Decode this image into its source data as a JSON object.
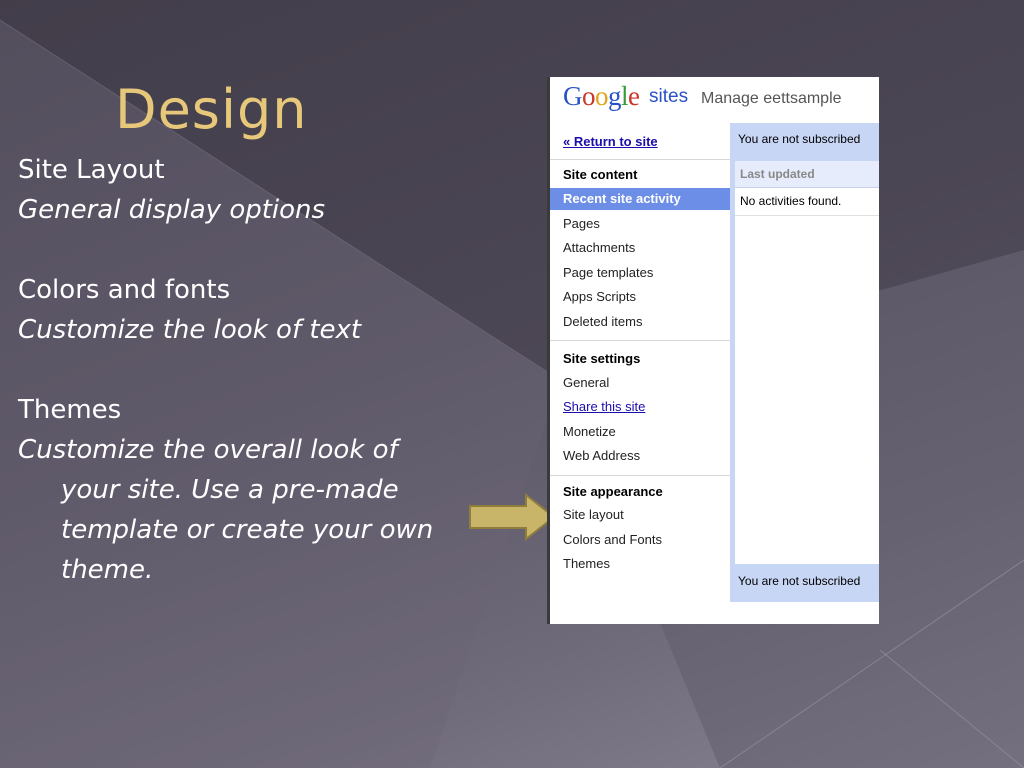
{
  "slide": {
    "title": "Design",
    "bullets": [
      {
        "text": "Site Layout"
      },
      {
        "text": "General display options"
      },
      {
        "text": "Colors and fonts"
      },
      {
        "text": "Customize the look of text"
      },
      {
        "text": "Themes"
      },
      {
        "text": "Customize the overall look of your site.  Use a pre-made template or create your own theme."
      }
    ],
    "arrow_icon": "right-arrow-icon",
    "accent_color": "#e7c87a",
    "arrow_color": "#c9b56a"
  },
  "screenshot": {
    "logo": {
      "google": "Google",
      "sites": "sites"
    },
    "header_title": "Manage eettsample",
    "return_link": "« Return to site",
    "sections": {
      "content": {
        "heading": "Site content",
        "items": [
          "Recent site activity",
          "Pages",
          "Attachments",
          "Page templates",
          "Apps Scripts",
          "Deleted items"
        ],
        "active": "Recent site activity"
      },
      "settings": {
        "heading": "Site settings",
        "items": [
          "General",
          "Share this site",
          "Monetize",
          "Web Address"
        ]
      },
      "appearance": {
        "heading": "Site appearance",
        "items": [
          "Site layout",
          "Colors and Fonts",
          "Themes"
        ]
      }
    },
    "main": {
      "banner_top": "You are not subscribed",
      "column_header": "Last updated",
      "empty_message": "No activities found.",
      "banner_bottom": "You are not subscribed"
    },
    "colors": {
      "active_item_bg": "#6d8ee6",
      "content_bg": "#c8d6f6"
    }
  }
}
